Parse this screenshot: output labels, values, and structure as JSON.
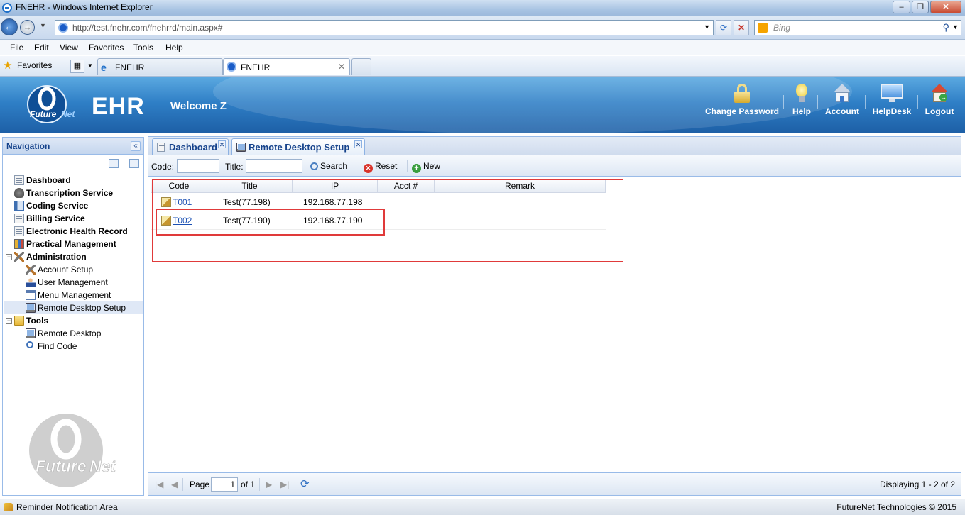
{
  "browser": {
    "window_title": "FNEHR - Windows Internet Explorer",
    "url": "http://test.fnehr.com/fnehrrd/main.aspx#",
    "search_placeholder": "Bing",
    "menu": [
      "File",
      "Edit",
      "View",
      "Favorites",
      "Tools",
      "Help"
    ],
    "favorites_label": "Favorites",
    "tabs": [
      {
        "label": "FNEHR"
      },
      {
        "label": "FNEHR"
      }
    ]
  },
  "header": {
    "app_name": "EHR",
    "welcome": "Welcome Z",
    "buttons": [
      {
        "label": "Change Password",
        "icon": "lock-icon"
      },
      {
        "label": "Help",
        "icon": "lightbulb-icon"
      },
      {
        "label": "Account",
        "icon": "house-icon"
      },
      {
        "label": "HelpDesk",
        "icon": "monitor-icon"
      },
      {
        "label": "Logout",
        "icon": "logout-house-icon"
      }
    ]
  },
  "navigation": {
    "title": "Navigation",
    "items": [
      {
        "label": "Dashboard",
        "icon": "document-icon"
      },
      {
        "label": "Transcription Service",
        "icon": "microphone-icon"
      },
      {
        "label": "Coding Service",
        "icon": "book-icon"
      },
      {
        "label": "Billing Service",
        "icon": "document-icon"
      },
      {
        "label": "Electronic Health Record",
        "icon": "document-icon"
      },
      {
        "label": "Practical Management",
        "icon": "chart-icon"
      },
      {
        "label": "Administration",
        "icon": "tools-icon"
      },
      {
        "label": "Account Setup",
        "icon": "tools-icon"
      },
      {
        "label": "User Management",
        "icon": "user-icon"
      },
      {
        "label": "Menu Management",
        "icon": "menu-icon"
      },
      {
        "label": "Remote Desktop Setup",
        "icon": "monitor-icon"
      },
      {
        "label": "Tools",
        "icon": "folder-icon"
      },
      {
        "label": "Remote Desktop",
        "icon": "monitor-icon"
      },
      {
        "label": "Find Code",
        "icon": "search-icon"
      }
    ]
  },
  "main": {
    "tabs": [
      {
        "label": "Dashboard"
      },
      {
        "label": "Remote Desktop Setup"
      }
    ],
    "toolbar": {
      "code_label": "Code:",
      "code_value": "",
      "title_label": "Title:",
      "title_value": "",
      "search_label": "Search",
      "reset_label": "Reset",
      "new_label": "New"
    },
    "grid": {
      "columns": [
        "Code",
        "Title",
        "IP",
        "Acct #",
        "Remark"
      ],
      "rows": [
        {
          "code": "T001",
          "title": "Test(77.198)",
          "ip": "192.168.77.198",
          "acct": "",
          "remark": ""
        },
        {
          "code": "T002",
          "title": "Test(77.190)",
          "ip": "192.168.77.190",
          "acct": "",
          "remark": ""
        }
      ]
    },
    "paging": {
      "page_label": "Page",
      "page_value": "1",
      "of_label": "of 1",
      "display_text": "Displaying 1 - 2 of 2"
    }
  },
  "statusbar": {
    "left": "Reminder Notification Area",
    "right": "FutureNet Technologies © 2015"
  },
  "colors": {
    "header_blue": "#2f7fc6",
    "panel_border": "#99bbe8",
    "highlight_red": "#e03a3a",
    "link_blue": "#1a4fb3"
  }
}
